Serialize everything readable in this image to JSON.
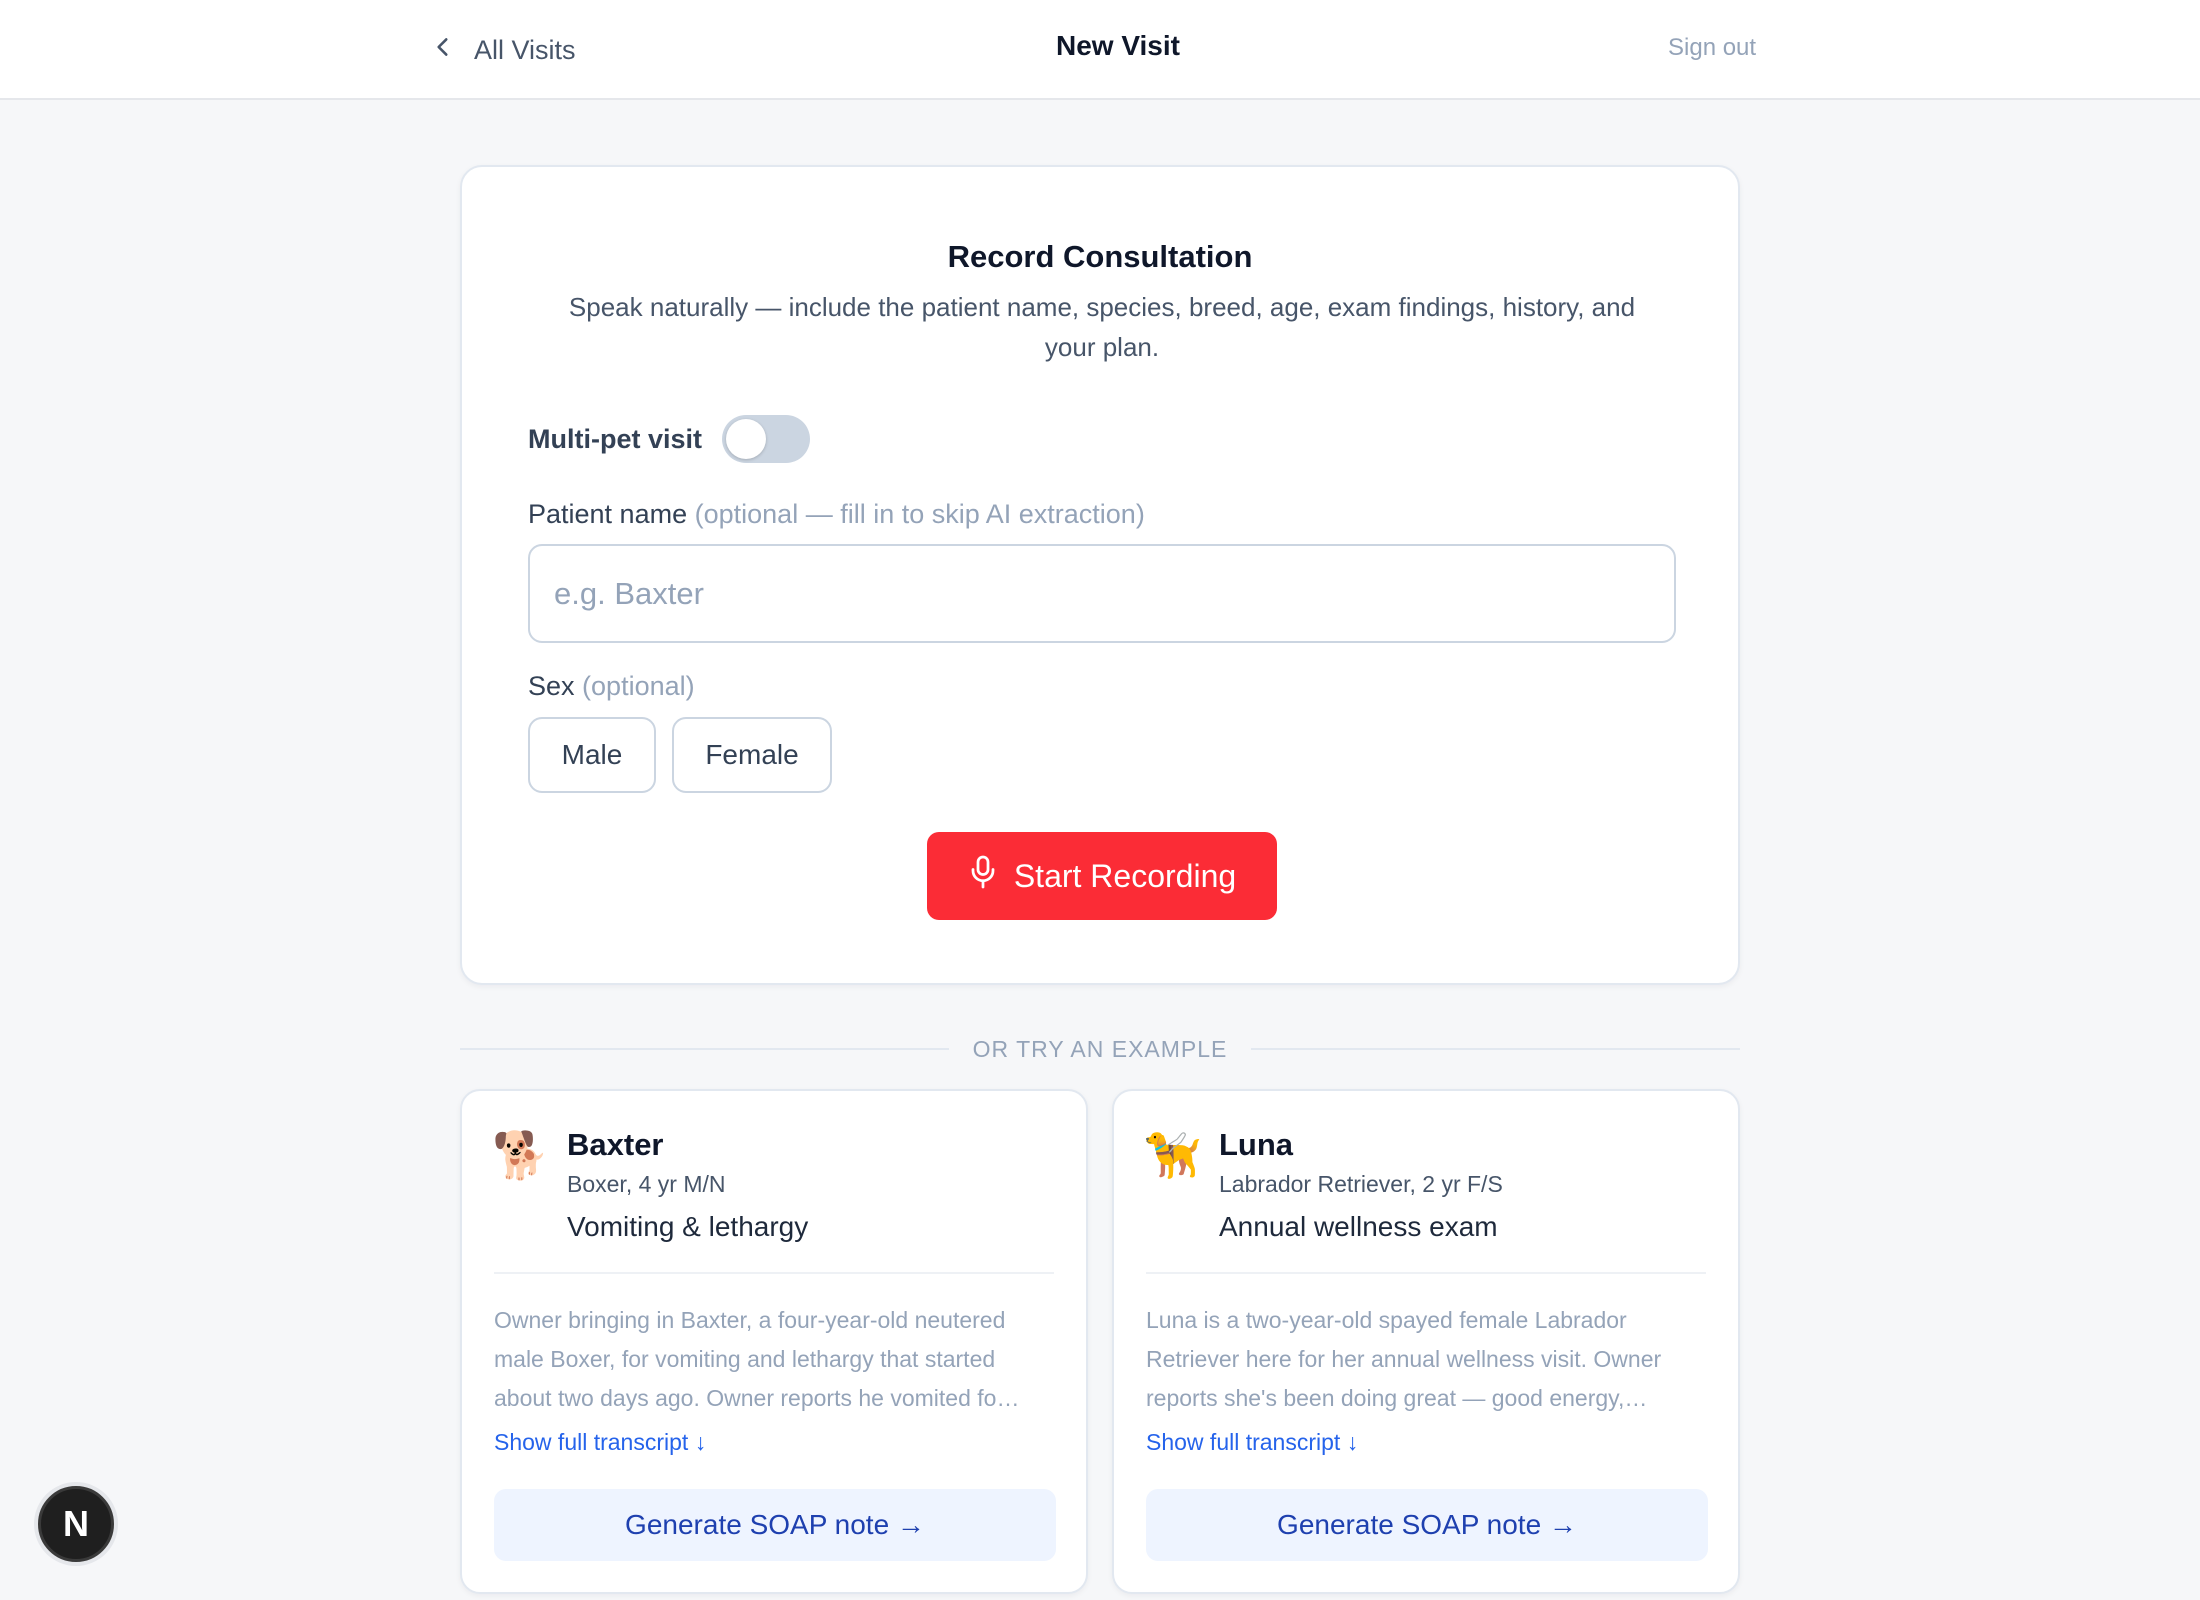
{
  "header": {
    "back_label": "All Visits",
    "title": "New Visit",
    "signout_label": "Sign out"
  },
  "record": {
    "title": "Record Consultation",
    "subtitle": "Speak naturally — include the patient name, species, breed, age, exam findings, history, and your plan.",
    "multipet_label": "Multi-pet visit",
    "multipet_enabled": false,
    "patient_label": "Patient name",
    "patient_hint": "(optional — fill in to skip AI extraction)",
    "patient_value": "",
    "patient_placeholder": "e.g. Baxter",
    "sex_label": "Sex",
    "sex_hint": "(optional)",
    "sex_options": [
      "Male",
      "Female"
    ],
    "start_label": "Start Recording"
  },
  "examples_divider": "OR TRY AN EXAMPLE",
  "examples": [
    {
      "emoji": "🐕",
      "name": "Baxter",
      "meta": "Boxer, 4 yr M/N",
      "reason": "Vomiting & lethargy",
      "transcript": "Owner bringing in Baxter, a four-year-old neutered male Boxer, for vomiting and lethargy that started about two days ago. Owner reports he vomited fo…",
      "link_label": "Show full transcript ↓",
      "button_label": "Generate SOAP note →"
    },
    {
      "emoji": "🦮",
      "name": "Luna",
      "meta": "Labrador Retriever, 2 yr F/S",
      "reason": "Annual wellness exam",
      "transcript": "Luna is a two-year-old spayed female Labrador Retriever here for her annual wellness visit. Owner reports she's been doing great — good energy,…",
      "link_label": "Show full transcript ↓",
      "button_label": "Generate SOAP note →"
    }
  ],
  "badge_letter": "N",
  "colors": {
    "record_button": "#fb2c36",
    "link": "#2563eb",
    "soap_button_bg": "#eef4ff"
  }
}
